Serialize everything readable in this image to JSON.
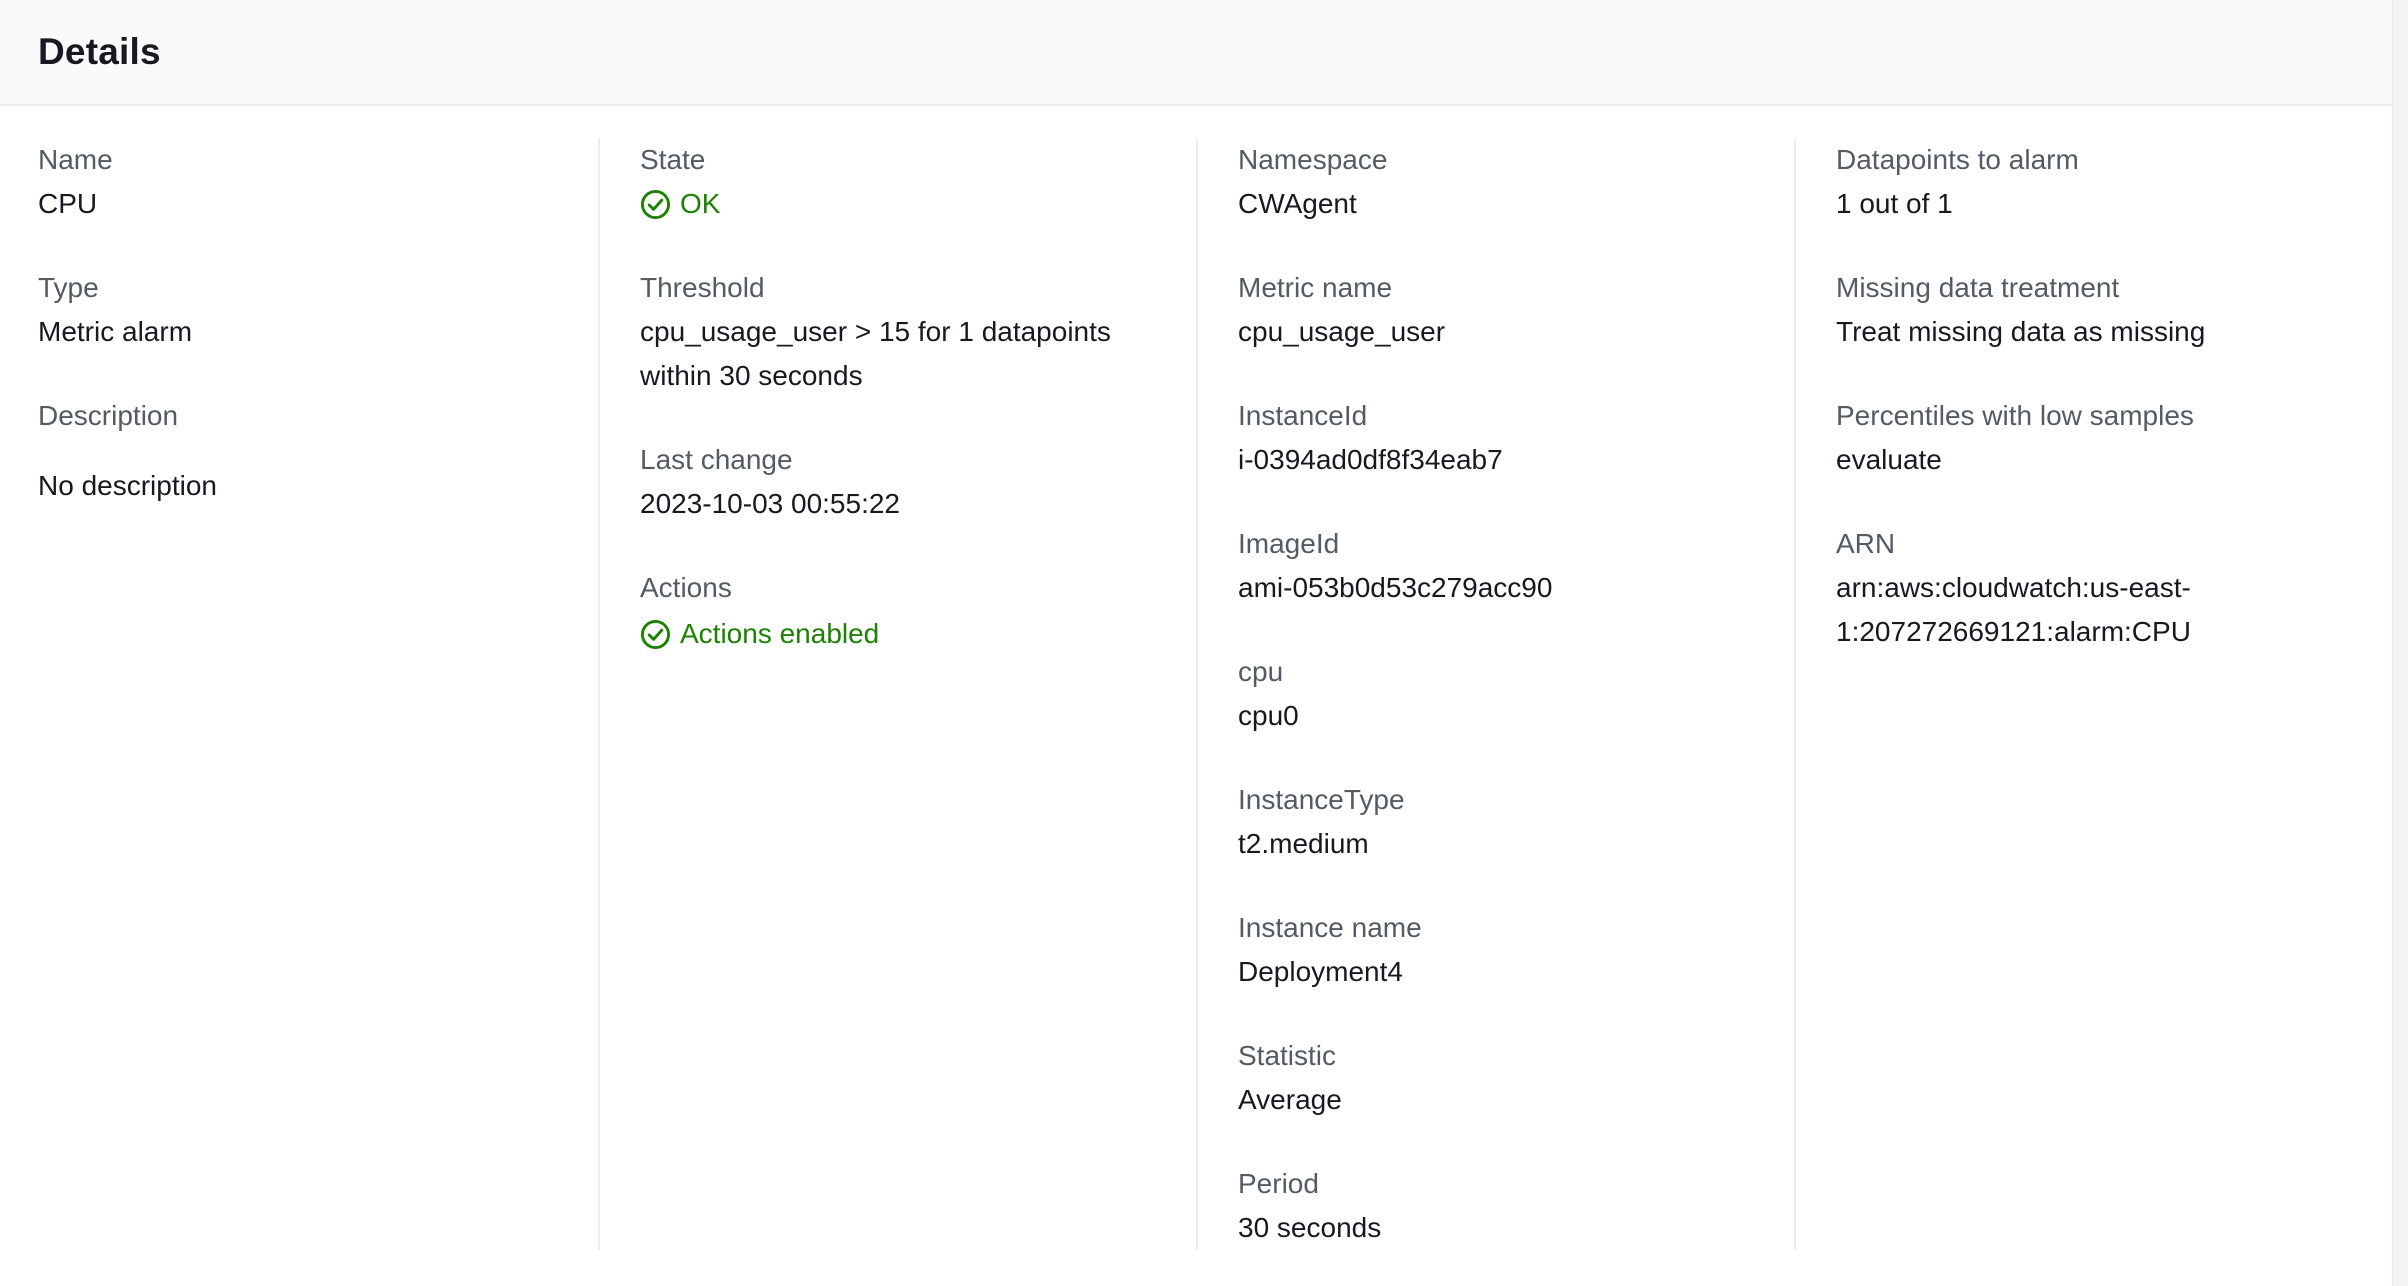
{
  "header": {
    "title": "Details"
  },
  "colors": {
    "success": "#1d8102",
    "label": "#545b64",
    "text": "#16191f"
  },
  "column1": {
    "name_label": "Name",
    "name_value": "CPU",
    "type_label": "Type",
    "type_value": "Metric alarm",
    "description_label": "Description",
    "description_value": "No description"
  },
  "column2": {
    "state_label": "State",
    "state_value": "OK",
    "state_icon": "check-circle-icon",
    "threshold_label": "Threshold",
    "threshold_value": "cpu_usage_user > 15 for 1 datapoints within 30 seconds",
    "last_change_label": "Last change",
    "last_change_value": "2023-10-03 00:55:22",
    "actions_label": "Actions",
    "actions_value": "Actions enabled",
    "actions_icon": "check-circle-icon"
  },
  "column3": {
    "namespace_label": "Namespace",
    "namespace_value": "CWAgent",
    "metric_name_label": "Metric name",
    "metric_name_value": "cpu_usage_user",
    "instance_id_label": "InstanceId",
    "instance_id_value": "i-0394ad0df8f34eab7",
    "image_id_label": "ImageId",
    "image_id_value": "ami-053b0d53c279acc90",
    "cpu_label": "cpu",
    "cpu_value": "cpu0",
    "instance_type_label": "InstanceType",
    "instance_type_value": "t2.medium",
    "instance_name_label": "Instance name",
    "instance_name_value": "Deployment4",
    "statistic_label": "Statistic",
    "statistic_value": "Average",
    "period_label": "Period",
    "period_value": "30 seconds"
  },
  "column4": {
    "datapoints_label": "Datapoints to alarm",
    "datapoints_value": "1 out of 1",
    "missing_data_label": "Missing data treatment",
    "missing_data_value": "Treat missing data as missing",
    "percentiles_label": "Percentiles with low samples",
    "percentiles_value": "evaluate",
    "arn_label": "ARN",
    "arn_value": "arn:aws:cloudwatch:us-east-1:207272669121:alarm:CPU"
  }
}
